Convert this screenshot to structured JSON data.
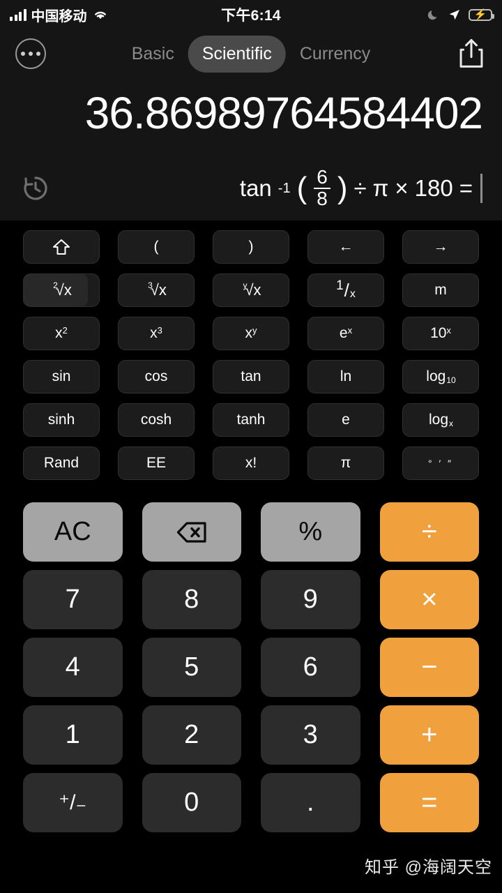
{
  "status_bar": {
    "carrier": "中国移动",
    "time": "下午6:14",
    "signal_icon": "signal-bars-icon",
    "wifi_icon": "wifi-icon",
    "dnd_icon": "moon-icon",
    "location_icon": "location-arrow-icon",
    "battery_icon": "battery-charging-icon"
  },
  "header": {
    "more_icon": "more-options-icon",
    "share_icon": "share-icon",
    "tabs": [
      {
        "label": "Basic",
        "active": false
      },
      {
        "label": "Scientific",
        "active": true
      },
      {
        "label": "Currency",
        "active": false
      }
    ]
  },
  "display": {
    "result": "36.86989764584402",
    "history_icon": "history-clock-icon",
    "expression": {
      "function": "tan",
      "exponent": "-1",
      "open_paren": "(",
      "numerator": "6",
      "denominator": "8",
      "close_paren": ")",
      "op1": "÷",
      "constant": "π",
      "op2": "×",
      "operand": "180",
      "equals": "="
    },
    "expression_text": "tan⁻¹(6/8) ÷ π × 180 ="
  },
  "function_pad": {
    "rows": [
      [
        {
          "name": "shift-key",
          "glyph": "⇧"
        },
        {
          "name": "open-paren-key",
          "label": "("
        },
        {
          "name": "close-paren-key",
          "label": ")"
        },
        {
          "name": "arrow-left-key",
          "label": "←"
        },
        {
          "name": "arrow-right-key",
          "label": "→"
        }
      ],
      [
        {
          "name": "square-root-key",
          "index": "2",
          "label": "√x",
          "highlighted": true
        },
        {
          "name": "cube-root-key",
          "index": "3",
          "label": "√x"
        },
        {
          "name": "nth-root-key",
          "index": "y",
          "label": "√x"
        },
        {
          "name": "reciprocal-key",
          "num": "1",
          "den": "x"
        },
        {
          "name": "memory-key",
          "label": "m"
        }
      ],
      [
        {
          "name": "x-squared-key",
          "base": "x",
          "sup": "2"
        },
        {
          "name": "x-cubed-key",
          "base": "x",
          "sup": "3"
        },
        {
          "name": "x-power-y-key",
          "base": "x",
          "sup": "y"
        },
        {
          "name": "e-power-x-key",
          "base": "e",
          "sup": "x"
        },
        {
          "name": "ten-power-x-key",
          "base": "10",
          "sup": "x"
        }
      ],
      [
        {
          "name": "sin-key",
          "label": "sin"
        },
        {
          "name": "cos-key",
          "label": "cos"
        },
        {
          "name": "tan-key",
          "label": "tan"
        },
        {
          "name": "ln-key",
          "label": "ln"
        },
        {
          "name": "log10-key",
          "base": "log",
          "sub": "10"
        }
      ],
      [
        {
          "name": "sinh-key",
          "label": "sinh"
        },
        {
          "name": "cosh-key",
          "label": "cosh"
        },
        {
          "name": "tanh-key",
          "label": "tanh"
        },
        {
          "name": "euler-key",
          "label": "e"
        },
        {
          "name": "log-base-x-key",
          "base": "log",
          "sub": "x"
        }
      ],
      [
        {
          "name": "rand-key",
          "label": "Rand"
        },
        {
          "name": "ee-key",
          "label": "EE"
        },
        {
          "name": "factorial-key",
          "label": "x!"
        },
        {
          "name": "pi-key",
          "label": "π"
        },
        {
          "name": "degrees-minutes-seconds-key",
          "label": "° ′ ″"
        }
      ]
    ]
  },
  "keypad": {
    "rows": [
      [
        {
          "name": "all-clear-key",
          "label": "AC",
          "style": "gray"
        },
        {
          "name": "backspace-key",
          "label": "",
          "style": "gray",
          "icon": "backspace-icon"
        },
        {
          "name": "percent-key",
          "label": "%",
          "style": "gray"
        },
        {
          "name": "divide-key",
          "label": "÷",
          "style": "op"
        }
      ],
      [
        {
          "name": "digit-7-key",
          "label": "7",
          "style": "num"
        },
        {
          "name": "digit-8-key",
          "label": "8",
          "style": "num"
        },
        {
          "name": "digit-9-key",
          "label": "9",
          "style": "num"
        },
        {
          "name": "multiply-key",
          "label": "×",
          "style": "op"
        }
      ],
      [
        {
          "name": "digit-4-key",
          "label": "4",
          "style": "num"
        },
        {
          "name": "digit-5-key",
          "label": "5",
          "style": "num"
        },
        {
          "name": "digit-6-key",
          "label": "6",
          "style": "num"
        },
        {
          "name": "subtract-key",
          "label": "−",
          "style": "op"
        }
      ],
      [
        {
          "name": "digit-1-key",
          "label": "1",
          "style": "num"
        },
        {
          "name": "digit-2-key",
          "label": "2",
          "style": "num"
        },
        {
          "name": "digit-3-key",
          "label": "3",
          "style": "num"
        },
        {
          "name": "add-key",
          "label": "+",
          "style": "op"
        }
      ],
      [
        {
          "name": "sign-toggle-key",
          "label": "⁺/₋",
          "style": "num"
        },
        {
          "name": "digit-0-key",
          "label": "0",
          "style": "num"
        },
        {
          "name": "decimal-point-key",
          "label": ".",
          "style": "num"
        },
        {
          "name": "equals-key",
          "label": "=",
          "style": "op"
        }
      ]
    ]
  },
  "watermark": {
    "text": "知乎 @海阔天空"
  },
  "colors": {
    "background": "#000000",
    "panel": "#151515",
    "number_key": "#2c2c2c",
    "function_key": "#1c1c1c",
    "gray_key": "#a5a5a5",
    "operator_orange": "#f0a03c",
    "active_tab": "#4a4a4a",
    "inactive_text": "#8b8b8b"
  }
}
